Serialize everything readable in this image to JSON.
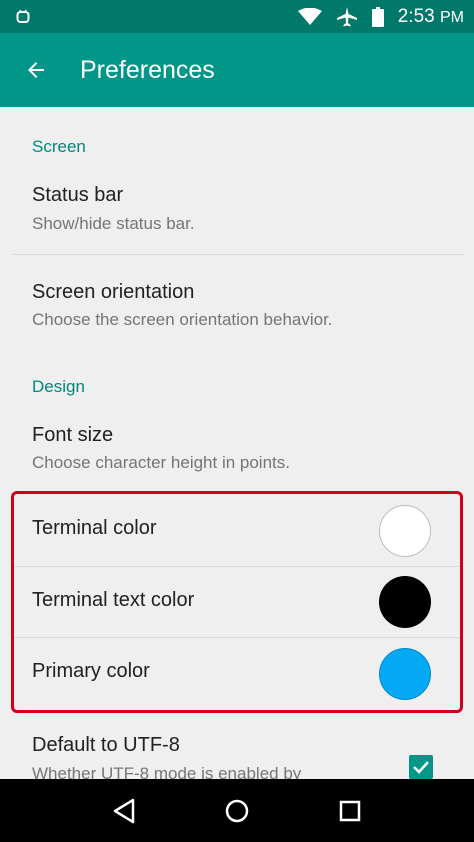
{
  "status_bar": {
    "time": "2:53",
    "ampm": "PM",
    "icons": [
      "android-debug-icon",
      "wifi-icon",
      "airplane-icon",
      "battery-icon"
    ]
  },
  "app_bar": {
    "title": "Preferences",
    "back_icon": "arrow-back-icon"
  },
  "sections": {
    "screen": {
      "header": "Screen",
      "status_bar": {
        "title": "Status bar",
        "summary": "Show/hide status bar."
      },
      "orientation": {
        "title": "Screen orientation",
        "summary": "Choose the screen orientation behavior."
      }
    },
    "design": {
      "header": "Design",
      "font_size": {
        "title": "Font size",
        "summary": "Choose character height in points."
      },
      "terminal_color": {
        "title": "Terminal color",
        "swatch": "#ffffff"
      },
      "terminal_text_color": {
        "title": "Terminal text color",
        "swatch": "#000000"
      },
      "primary_color": {
        "title": "Primary color",
        "swatch": "#03a9f4"
      },
      "utf8": {
        "title": "Default to UTF-8",
        "summary": "Whether UTF-8 mode is enabled by",
        "checked": true
      }
    }
  },
  "colors": {
    "accent": "#009688",
    "status_bar": "#00796b",
    "highlight": "#d0021b"
  },
  "nav_bar": {
    "icons": [
      "back-triangle-icon",
      "home-circle-icon",
      "recents-square-icon"
    ]
  }
}
